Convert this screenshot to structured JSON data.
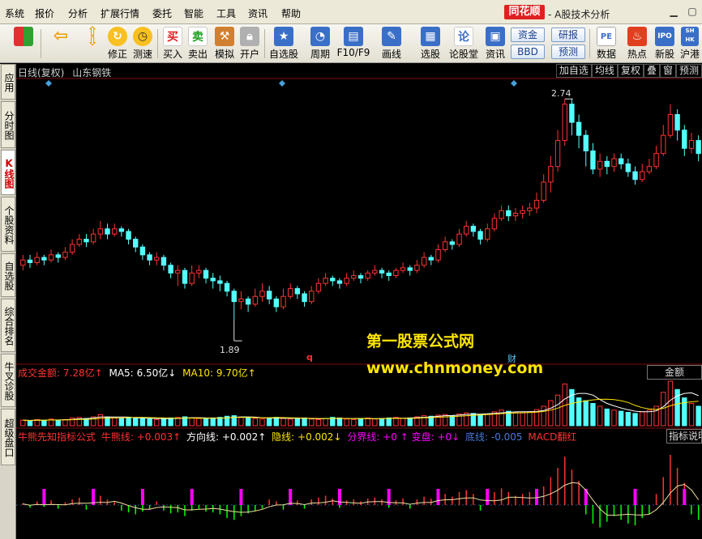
{
  "menubar": {
    "items": [
      "系统",
      "报价",
      "分析",
      "扩展行情",
      "委托",
      "智能",
      "工具",
      "资讯",
      "帮助"
    ],
    "logo": "同花顺",
    "title": "- A股技术分析"
  },
  "toolbar": {
    "items": [
      {
        "label": "修正",
        "icon": "refresh-icon",
        "color": "#f0a000"
      },
      {
        "label": "测速",
        "icon": "clock-icon",
        "color": "#f0a000"
      },
      {
        "label": "买入",
        "icon": "buy-icon",
        "text": "买",
        "color": "#ffffff"
      },
      {
        "label": "卖出",
        "icon": "sell-icon",
        "text": "卖",
        "color": "#ffffff"
      },
      {
        "label": "模拟",
        "icon": "hammer-icon",
        "color": "#d08030"
      },
      {
        "label": "开户",
        "icon": "lock-icon",
        "color": "#a0a0a0"
      },
      {
        "label": "自选股",
        "icon": "star-icon",
        "color": "#3060c0"
      },
      {
        "label": "周期",
        "icon": "period-icon",
        "color": "#3060c0"
      },
      {
        "label": "F10/F9",
        "icon": "f10-icon",
        "color": "#3060c0"
      },
      {
        "label": "画线",
        "icon": "pen-icon",
        "color": "#3060c0"
      },
      {
        "label": "选股",
        "icon": "select-icon",
        "color": "#3060c0"
      },
      {
        "label": "论股堂",
        "icon": "forum-icon",
        "text": "论",
        "color": "#3060c0"
      },
      {
        "label": "资讯",
        "icon": "news-icon",
        "color": "#3060c0"
      },
      {
        "label": "数据",
        "icon": "pe-icon",
        "text": "PE",
        "color": "#3060c0"
      },
      {
        "label": "热点",
        "icon": "hot-icon",
        "color": "#e04020"
      },
      {
        "label": "新股",
        "icon": "ipo-icon",
        "text": "IPO",
        "color": "#3060c0"
      },
      {
        "label": "沪港",
        "icon": "sh-hk-icon",
        "text": "SH HK",
        "color": "#3060c0"
      }
    ],
    "pills": [
      "资金",
      "研报",
      "BBD",
      "预测"
    ]
  },
  "lefttabs": [
    {
      "label": "应用"
    },
    {
      "label": "分时图"
    },
    {
      "label": "K线图",
      "active": true
    },
    {
      "label": "个股资料"
    },
    {
      "label": "自选股"
    },
    {
      "label": "综合排名"
    },
    {
      "label": "牛叉诊股"
    },
    {
      "label": "超级盘口"
    }
  ],
  "chart_header": {
    "period": "日线(复权)",
    "stock": "山东钢铁"
  },
  "chart_tools": [
    "加自选",
    "均线",
    "复权",
    "叠",
    "窗",
    "预测"
  ],
  "price_marks": {
    "high": "2.74",
    "low": "1.89"
  },
  "vol_header": {
    "amount_label": "成交金额:",
    "amount_value": "7.28亿↑",
    "ma5_label": "MA5:",
    "ma5_value": "6.50亿↓",
    "ma10_label": "MA10:",
    "ma10_value": "9.70亿↑",
    "button": "金额"
  },
  "ind_header": {
    "name": "牛熊先知指标公式",
    "line1": "牛熊线: +0.003↑",
    "line2": "方向线: +0.002↑",
    "line3": "隐线: +0.002↓",
    "line4": "分界线: +0",
    "line5": "↑ 变盘: +0↓",
    "line6": "底线: -0.005",
    "line7": "MACD翻红",
    "button": "指标说明"
  },
  "watermark": {
    "line1": "第一股票公式网",
    "line2": "www.chnmoney.com"
  },
  "markers": {
    "q": "q",
    "cai": "财"
  },
  "colors": {
    "up": "#ff3232",
    "down": "#54ffff",
    "ma": "#ffffff",
    "yellow": "#ffe600",
    "purple": "#ff00ff",
    "green": "#00ff00",
    "diamond": "#4aa0d8"
  },
  "chart_data": {
    "type": "candlestick",
    "title": "",
    "ylim": [
      1.8,
      2.8
    ],
    "annotations": [
      {
        "label": "2.74",
        "value": 2.74
      },
      {
        "label": "1.89",
        "value": 1.89
      }
    ],
    "candles": [
      [
        2.1,
        2.12,
        2.08,
        2.14
      ],
      [
        2.12,
        2.11,
        2.09,
        2.14
      ],
      [
        2.11,
        2.13,
        2.1,
        2.15
      ],
      [
        2.13,
        2.12,
        2.1,
        2.14
      ],
      [
        2.12,
        2.14,
        2.11,
        2.16
      ],
      [
        2.14,
        2.13,
        2.11,
        2.15
      ],
      [
        2.13,
        2.15,
        2.12,
        2.17
      ],
      [
        2.15,
        2.18,
        2.14,
        2.2
      ],
      [
        2.18,
        2.2,
        2.17,
        2.22
      ],
      [
        2.2,
        2.19,
        2.17,
        2.22
      ],
      [
        2.19,
        2.22,
        2.18,
        2.24
      ],
      [
        2.22,
        2.24,
        2.2,
        2.27
      ],
      [
        2.24,
        2.22,
        2.2,
        2.26
      ],
      [
        2.22,
        2.24,
        2.21,
        2.26
      ],
      [
        2.24,
        2.23,
        2.21,
        2.25
      ],
      [
        2.23,
        2.2,
        2.18,
        2.24
      ],
      [
        2.2,
        2.17,
        2.15,
        2.21
      ],
      [
        2.17,
        2.14,
        2.12,
        2.18
      ],
      [
        2.14,
        2.12,
        2.1,
        2.15
      ],
      [
        2.12,
        2.13,
        2.1,
        2.15
      ],
      [
        2.13,
        2.1,
        2.08,
        2.14
      ],
      [
        2.1,
        2.07,
        2.05,
        2.11
      ],
      [
        2.07,
        2.08,
        2.02,
        2.1
      ],
      [
        2.08,
        2.03,
        2.01,
        2.09
      ],
      [
        2.03,
        2.07,
        2.02,
        2.1
      ],
      [
        2.07,
        2.08,
        2.05,
        2.1
      ],
      [
        2.08,
        2.05,
        2.03,
        2.09
      ],
      [
        2.05,
        2.04,
        2.01,
        2.07
      ],
      [
        2.04,
        2.03,
        2.0,
        2.06
      ],
      [
        2.03,
        2.0,
        1.98,
        2.04
      ],
      [
        2.0,
        1.96,
        1.89,
        2.01
      ],
      [
        1.96,
        1.97,
        1.93,
        2.0
      ],
      [
        1.97,
        1.95,
        1.92,
        1.98
      ],
      [
        1.95,
        1.98,
        1.94,
        2.01
      ],
      [
        1.98,
        2.0,
        1.96,
        2.03
      ],
      [
        2.0,
        1.97,
        1.95,
        2.02
      ],
      [
        1.97,
        1.94,
        1.92,
        1.98
      ],
      [
        1.94,
        1.98,
        1.93,
        2.01
      ],
      [
        1.98,
        2.01,
        1.97,
        2.03
      ],
      [
        2.01,
        1.99,
        1.97,
        2.02
      ],
      [
        1.99,
        1.96,
        1.94,
        2.0
      ],
      [
        1.96,
        2.0,
        1.95,
        2.02
      ],
      [
        2.0,
        2.03,
        1.99,
        2.05
      ],
      [
        2.03,
        2.05,
        2.02,
        2.07
      ],
      [
        2.05,
        2.04,
        2.02,
        2.06
      ],
      [
        2.04,
        2.03,
        2.01,
        2.05
      ],
      [
        2.03,
        2.05,
        2.02,
        2.07
      ],
      [
        2.05,
        2.06,
        2.04,
        2.08
      ],
      [
        2.06,
        2.05,
        2.03,
        2.07
      ],
      [
        2.05,
        2.07,
        2.04,
        2.08
      ],
      [
        2.07,
        2.08,
        2.06,
        2.1
      ],
      [
        2.08,
        2.07,
        2.05,
        2.09
      ],
      [
        2.07,
        2.06,
        2.04,
        2.08
      ],
      [
        2.06,
        2.08,
        2.05,
        2.09
      ],
      [
        2.08,
        2.09,
        2.07,
        2.11
      ],
      [
        2.09,
        2.08,
        2.06,
        2.1
      ],
      [
        2.08,
        2.1,
        2.07,
        2.12
      ],
      [
        2.1,
        2.13,
        2.09,
        2.15
      ],
      [
        2.13,
        2.12,
        2.1,
        2.14
      ],
      [
        2.12,
        2.16,
        2.11,
        2.18
      ],
      [
        2.16,
        2.19,
        2.15,
        2.21
      ],
      [
        2.19,
        2.18,
        2.16,
        2.2
      ],
      [
        2.18,
        2.22,
        2.17,
        2.24
      ],
      [
        2.22,
        2.25,
        2.21,
        2.27
      ],
      [
        2.25,
        2.23,
        2.21,
        2.26
      ],
      [
        2.23,
        2.2,
        2.18,
        2.24
      ],
      [
        2.2,
        2.24,
        2.19,
        2.26
      ],
      [
        2.24,
        2.28,
        2.23,
        2.3
      ],
      [
        2.28,
        2.31,
        2.27,
        2.33
      ],
      [
        2.31,
        2.29,
        2.27,
        2.33
      ],
      [
        2.29,
        2.3,
        2.27,
        2.32
      ],
      [
        2.3,
        2.31,
        2.28,
        2.33
      ],
      [
        2.31,
        2.32,
        2.29,
        2.34
      ],
      [
        2.32,
        2.35,
        2.3,
        2.38
      ],
      [
        2.35,
        2.42,
        2.34,
        2.45
      ],
      [
        2.42,
        2.48,
        2.38,
        2.52
      ],
      [
        2.48,
        2.58,
        2.46,
        2.62
      ],
      [
        2.58,
        2.72,
        2.56,
        2.74
      ],
      [
        2.72,
        2.65,
        2.6,
        2.74
      ],
      [
        2.65,
        2.6,
        2.55,
        2.68
      ],
      [
        2.6,
        2.54,
        2.48,
        2.62
      ],
      [
        2.54,
        2.47,
        2.45,
        2.57
      ],
      [
        2.47,
        2.5,
        2.44,
        2.53
      ],
      [
        2.5,
        2.48,
        2.45,
        2.52
      ],
      [
        2.48,
        2.51,
        2.46,
        2.53
      ],
      [
        2.51,
        2.49,
        2.47,
        2.53
      ],
      [
        2.49,
        2.46,
        2.44,
        2.51
      ],
      [
        2.46,
        2.43,
        2.41,
        2.48
      ],
      [
        2.43,
        2.46,
        2.42,
        2.49
      ],
      [
        2.46,
        2.48,
        2.45,
        2.51
      ],
      [
        2.48,
        2.53,
        2.47,
        2.56
      ],
      [
        2.53,
        2.6,
        2.52,
        2.64
      ],
      [
        2.6,
        2.68,
        2.59,
        2.72
      ],
      [
        2.68,
        2.62,
        2.58,
        2.7
      ],
      [
        2.62,
        2.55,
        2.52,
        2.64
      ],
      [
        2.55,
        2.58,
        2.53,
        2.61
      ],
      [
        2.58,
        2.53,
        2.5,
        2.6
      ]
    ],
    "volume": [
      20,
      18,
      22,
      19,
      24,
      20,
      22,
      28,
      30,
      26,
      32,
      40,
      30,
      28,
      26,
      30,
      28,
      26,
      24,
      22,
      26,
      28,
      30,
      32,
      28,
      26,
      24,
      28,
      30,
      34,
      36,
      30,
      28,
      26,
      24,
      28,
      30,
      26,
      24,
      26,
      28,
      24,
      22,
      26,
      30,
      28,
      24,
      22,
      26,
      28,
      24,
      26,
      28,
      30,
      26,
      28,
      32,
      36,
      34,
      38,
      40,
      36,
      42,
      46,
      44,
      40,
      42,
      50,
      56,
      52,
      48,
      46,
      50,
      58,
      70,
      90,
      110,
      150,
      130,
      100,
      90,
      80,
      70,
      60,
      56,
      52,
      48,
      44,
      50,
      56,
      70,
      120,
      160,
      130,
      100,
      80,
      70
    ],
    "ind": [
      2,
      -3,
      4,
      -2,
      5,
      -4,
      3,
      6,
      8,
      -5,
      7,
      10,
      6,
      4,
      -6,
      -8,
      -10,
      -7,
      -5,
      4,
      -6,
      -9,
      -8,
      -12,
      -6,
      -4,
      -7,
      -8,
      -10,
      -14,
      -16,
      -12,
      -9,
      -6,
      -4,
      6,
      4,
      -5,
      7,
      5,
      -4,
      6,
      8,
      10,
      7,
      -3,
      5,
      6,
      4,
      7,
      8,
      6,
      -3,
      5,
      7,
      -4,
      6,
      9,
      7,
      10,
      12,
      9,
      14,
      16,
      12,
      -6,
      10,
      14,
      18,
      14,
      10,
      12,
      14,
      16,
      20,
      30,
      40,
      52,
      38,
      26,
      -10,
      -20,
      -24,
      -18,
      -12,
      -16,
      -20,
      -22,
      -14,
      -10,
      12,
      30,
      54,
      40,
      24,
      -10,
      -16
    ]
  }
}
